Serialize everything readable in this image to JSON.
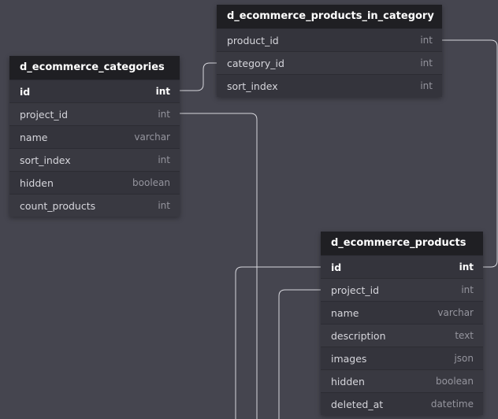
{
  "tables": [
    {
      "id": "categories",
      "name": "d_ecommerce_categories",
      "fields": [
        {
          "name": "id",
          "type": "int",
          "pk": true
        },
        {
          "name": "project_id",
          "type": "int",
          "pk": false
        },
        {
          "name": "name",
          "type": "varchar",
          "pk": false
        },
        {
          "name": "sort_index",
          "type": "int",
          "pk": false
        },
        {
          "name": "hidden",
          "type": "boolean",
          "pk": false
        },
        {
          "name": "count_products",
          "type": "int",
          "pk": false
        }
      ]
    },
    {
      "id": "products_in_category",
      "name": "d_ecommerce_products_in_category",
      "fields": [
        {
          "name": "product_id",
          "type": "int",
          "pk": false
        },
        {
          "name": "category_id",
          "type": "int",
          "pk": false
        },
        {
          "name": "sort_index",
          "type": "int",
          "pk": false
        }
      ]
    },
    {
      "id": "products",
      "name": "d_ecommerce_products",
      "fields": [
        {
          "name": "id",
          "type": "int",
          "pk": true
        },
        {
          "name": "project_id",
          "type": "int",
          "pk": false
        },
        {
          "name": "name",
          "type": "varchar",
          "pk": false
        },
        {
          "name": "description",
          "type": "text",
          "pk": false
        },
        {
          "name": "images",
          "type": "json",
          "pk": false
        },
        {
          "name": "hidden",
          "type": "boolean",
          "pk": false
        },
        {
          "name": "deleted_at",
          "type": "datetime",
          "pk": false
        }
      ]
    }
  ],
  "colors": {
    "background": "#45454f",
    "header": "#1f1f23",
    "connector": "#d8d8de"
  }
}
